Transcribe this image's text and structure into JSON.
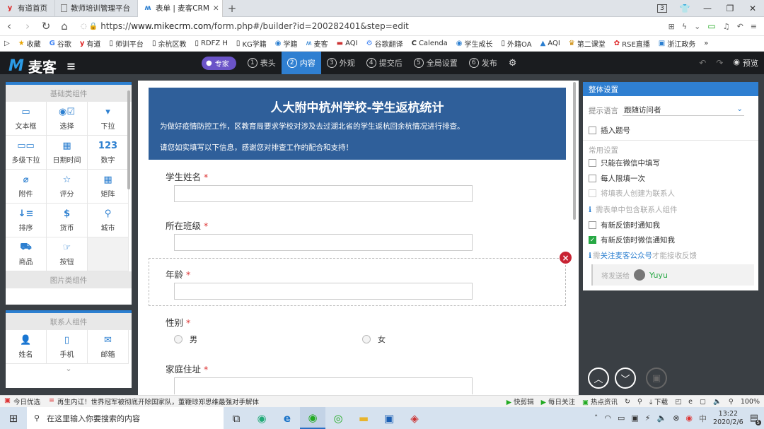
{
  "browser": {
    "tabs": [
      {
        "label": "有道首页",
        "icon": "youdao-icon"
      },
      {
        "label": "教师培训管理平台",
        "icon": "page-icon"
      },
      {
        "label": "表单 | 麦客CRM",
        "icon": "mikecrm-icon",
        "active": true
      }
    ],
    "new_tab": "+",
    "tab_count": "3",
    "url_prefix": "https://",
    "url_domain": "www.mikecrm.com",
    "url_rest": "/form.php#/builder?id=200282401&step=edit",
    "bookmarks": [
      "收藏",
      "谷歌",
      "有道",
      "师训平台",
      "余杭区教",
      "RDFZ H",
      "KG学籍",
      "学籍",
      "麦客",
      "AQI",
      "谷歌翻译",
      "Calenda",
      "学生成长",
      "外籍OA",
      "AQI",
      "第二课堂",
      "RSE直播",
      "浙江政务"
    ],
    "more": "»"
  },
  "app": {
    "logo_text": "麦客",
    "pro_label": "专家",
    "steps": [
      {
        "num": "1",
        "label": "表头"
      },
      {
        "num": "2",
        "label": "内容",
        "active": true
      },
      {
        "num": "3",
        "label": "外观"
      },
      {
        "num": "4",
        "label": "提交后"
      },
      {
        "num": "5",
        "label": "全局设置"
      },
      {
        "num": "6",
        "label": "发布"
      }
    ],
    "preview_label": "预览"
  },
  "left_panel": {
    "basic_title": "基础类组件",
    "basic_items": [
      {
        "label": "文本框",
        "glyph": "▭"
      },
      {
        "label": "选择",
        "glyph": "◉☑"
      },
      {
        "label": "下拉",
        "glyph": "▾"
      },
      {
        "label": "多级下拉",
        "glyph": "▭▭"
      },
      {
        "label": "日期时间",
        "glyph": "▦"
      },
      {
        "label": "数字",
        "glyph": "123"
      },
      {
        "label": "附件",
        "glyph": "⌀"
      },
      {
        "label": "评分",
        "glyph": "☆"
      },
      {
        "label": "矩阵",
        "glyph": "▦"
      },
      {
        "label": "排序",
        "glyph": "↓≡"
      },
      {
        "label": "货币",
        "glyph": "$"
      },
      {
        "label": "城市",
        "glyph": "⚲"
      },
      {
        "label": "商品",
        "glyph": "⛟"
      },
      {
        "label": "按钮",
        "glyph": "☞"
      }
    ],
    "image_title": "图片类组件",
    "contact_title": "联系人组件",
    "contact_items": [
      {
        "label": "姓名",
        "glyph": "👤"
      },
      {
        "label": "手机",
        "glyph": "▯"
      },
      {
        "label": "邮箱",
        "glyph": "✉"
      }
    ]
  },
  "form": {
    "title": "人大附中杭州学校-学生返杭统计",
    "desc1": "为做好疫情防控工作，区教育局要求学校对涉及去过湖北省的学生返杭回余杭情况进行排查。",
    "desc2": "请您如实填写以下信息，感谢您对排查工作的配合和支持！",
    "questions": [
      {
        "label": "学生姓名",
        "type": "text"
      },
      {
        "label": "所在班级",
        "type": "text"
      },
      {
        "label": "年龄",
        "type": "text"
      },
      {
        "label": "性别",
        "type": "radio",
        "options": [
          "男",
          "女"
        ]
      },
      {
        "label": "家庭住址",
        "type": "text"
      }
    ],
    "required_mark": "*"
  },
  "right_panel": {
    "title": "整体设置",
    "lang_label": "提示语言",
    "lang_value": "跟随访问者",
    "insert_number": "插入题号",
    "common_title": "常用设置",
    "opt_wechat_only": "只能在微信中填写",
    "opt_once": "每人限填一次",
    "opt_contact": "将填表人创建为联系人",
    "note_contact": "需表单中包含联系人组件",
    "opt_notify": "有新反馈时通知我",
    "opt_wechat_notify": "有新反馈时微信通知我",
    "note_follow_pre": "需",
    "note_follow_link": "关注麦客公众号",
    "note_follow_post": "才能接收反馈",
    "send_to": "将发送给",
    "user_name": "Yuyu"
  },
  "statusbar": {
    "left": "今日优选",
    "news": "再生内讧！世界冠军被彻底开除国家队，董鞭琼郑思维最强对手解体",
    "items": [
      "快剪辑",
      "每日关注",
      "热点资讯"
    ],
    "download": "下载",
    "zoom": "100%"
  },
  "taskbar": {
    "search_placeholder": "在这里输入你要搜索的内容",
    "time": "13:22",
    "date": "2020/2/6",
    "notif_count": "5"
  }
}
